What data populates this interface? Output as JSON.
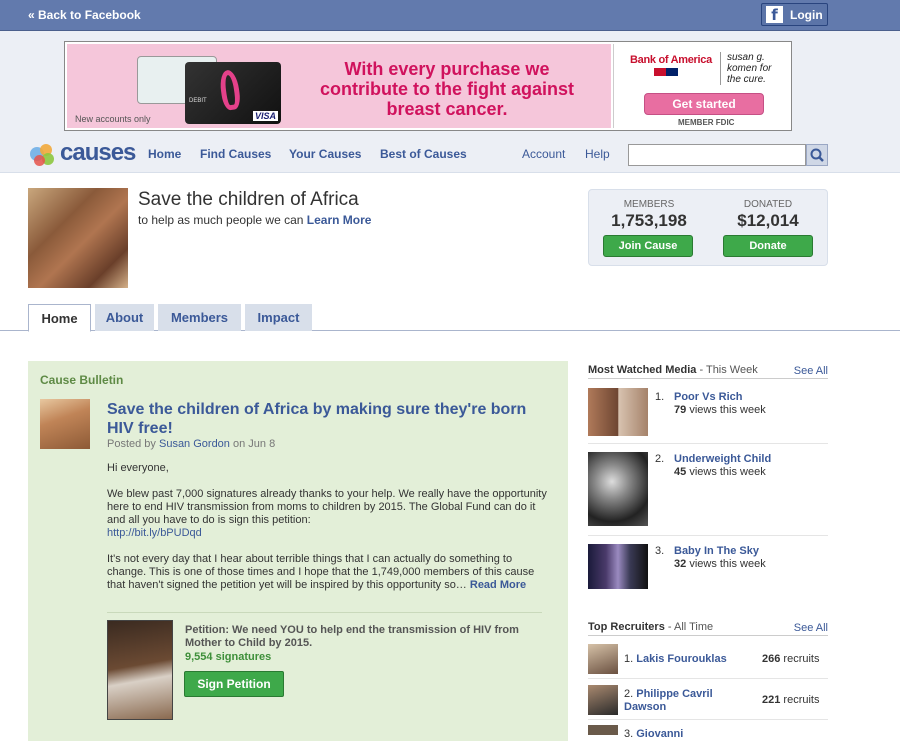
{
  "facebook_bar": {
    "back_link": "« Back to Facebook",
    "login_label": "Login",
    "fb_glyph": "f"
  },
  "ad": {
    "headline": "With every purchase we contribute to the fight against breast cancer.",
    "new_accounts": "New accounts only",
    "bank_name": "Bank of America",
    "partner": "susan g. komen for the cure.",
    "cta": "Get started",
    "fdic": "MEMBER FDIC",
    "card_brand": "VISA",
    "card_type": "DEBIT"
  },
  "nav": {
    "logo_text": "causes",
    "links": [
      "Home",
      "Find Causes",
      "Your Causes",
      "Best of Causes"
    ],
    "account": "Account",
    "help": "Help",
    "search_value": ""
  },
  "cause": {
    "title": "Save the children of Africa",
    "subtitle": "to help as much people we can",
    "learn_more": "Learn More",
    "members_label": "MEMBERS",
    "members_value": "1,753,198",
    "donated_label": "DONATED",
    "donated_value": "$12,014",
    "join_label": "Join Cause",
    "donate_label": "Donate"
  },
  "tabs": [
    "Home",
    "About",
    "Members",
    "Impact"
  ],
  "bulletin": {
    "heading": "Cause Bulletin",
    "post_title": "Save the children of Africa by making sure they're born HIV free!",
    "posted_by": "Posted by",
    "author": "Susan Gordon",
    "date": "on Jun 8",
    "greeting": "Hi everyone,",
    "para1": "We blew past 7,000 signatures already thanks to your help. We really have the opportunity here to end HIV transmission from moms to children by 2015. The Global Fund can do it and all you have to do is sign this petition:",
    "link": "http://bit.ly/bPUDqd",
    "para2": "It's not every day that I hear about terrible things that I can actually do something to change. This is one of those times and I hope that the 1,749,000 members of this cause that haven't signed the petition yet will be inspired by this opportunity so…",
    "read_more": "Read More",
    "petition_text": "Petition: We need YOU to help end the transmission of HIV from Mother to Child by 2015.",
    "signatures": "9,554 signatures",
    "sign_button": "Sign Petition"
  },
  "media": {
    "heading": "Most Watched Media",
    "period": "- This Week",
    "see_all": "See All",
    "items": [
      {
        "num": "1.",
        "title": "Poor Vs Rich",
        "views": "79",
        "views_suffix": "views this week"
      },
      {
        "num": "2.",
        "title": "Underweight Child",
        "views": "45",
        "views_suffix": "views this week"
      },
      {
        "num": "3.",
        "title": "Baby In The Sky",
        "views": "32",
        "views_suffix": "views this week"
      }
    ]
  },
  "recruiters": {
    "heading": "Top Recruiters",
    "period": "- All Time",
    "see_all": "See All",
    "items": [
      {
        "num": "1.",
        "name": "Lakis Fourouklas",
        "count": "266",
        "suffix": "recruits"
      },
      {
        "num": "2.",
        "name": "Philippe Cavril Dawson",
        "count": "221",
        "suffix": "recruits"
      },
      {
        "num": "3.",
        "name": "Giovanni",
        "count": "",
        "suffix": ""
      }
    ]
  }
}
